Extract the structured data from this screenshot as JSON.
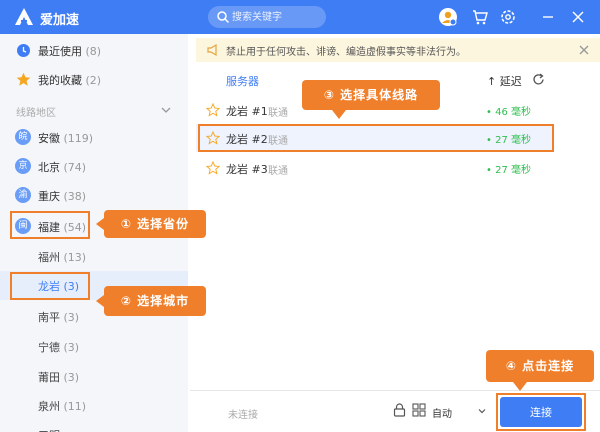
{
  "header": {
    "app_title": "爱加速",
    "search_placeholder": "搜索关键字"
  },
  "sidebar": {
    "top_items": [
      {
        "label": "最近使用",
        "count": "(8)"
      },
      {
        "label": "我的收藏",
        "count": "(2)"
      }
    ],
    "section_label": "线路地区",
    "provinces": [
      {
        "badge": "皖",
        "label": "安徽",
        "count": "(119)"
      },
      {
        "badge": "京",
        "label": "北京",
        "count": "(74)"
      },
      {
        "badge": "渝",
        "label": "重庆",
        "count": "(38)"
      },
      {
        "badge": "闽",
        "label": "福建",
        "count": "(54)"
      }
    ],
    "cities": [
      {
        "label": "福州",
        "count": "(13)"
      },
      {
        "label": "龙岩",
        "count": "(3)"
      },
      {
        "label": "南平",
        "count": "(3)"
      },
      {
        "label": "宁德",
        "count": "(3)"
      },
      {
        "label": "莆田",
        "count": "(3)"
      },
      {
        "label": "泉州",
        "count": "(11)"
      },
      {
        "label": "三明",
        "count": ""
      }
    ]
  },
  "notice": {
    "text": "禁止用于任何攻击、诽谤、编造虚假事实等非法行为。"
  },
  "list": {
    "col_server": "服务器",
    "col_latency": "↑ 延迟",
    "rows": [
      {
        "name": "龙岩 #1",
        "isp": "联通",
        "latency": "• 46 毫秒"
      },
      {
        "name": "龙岩 #2",
        "isp": "联通",
        "latency": "• 27 毫秒"
      },
      {
        "name": "龙岩 #3",
        "isp": "联通",
        "latency": "• 27 毫秒"
      }
    ]
  },
  "footer": {
    "status": "未连接",
    "mode": "自动",
    "connect_label": "连接"
  },
  "annotations": {
    "step1": "① 选择省份",
    "step2": "② 选择城市",
    "step3": "③ 选择具体线路",
    "step4": "④ 点击连接"
  },
  "colors": {
    "accent": "#3f7df5",
    "annotation": "#f07f2b",
    "latency_good": "#2fbf4f"
  }
}
